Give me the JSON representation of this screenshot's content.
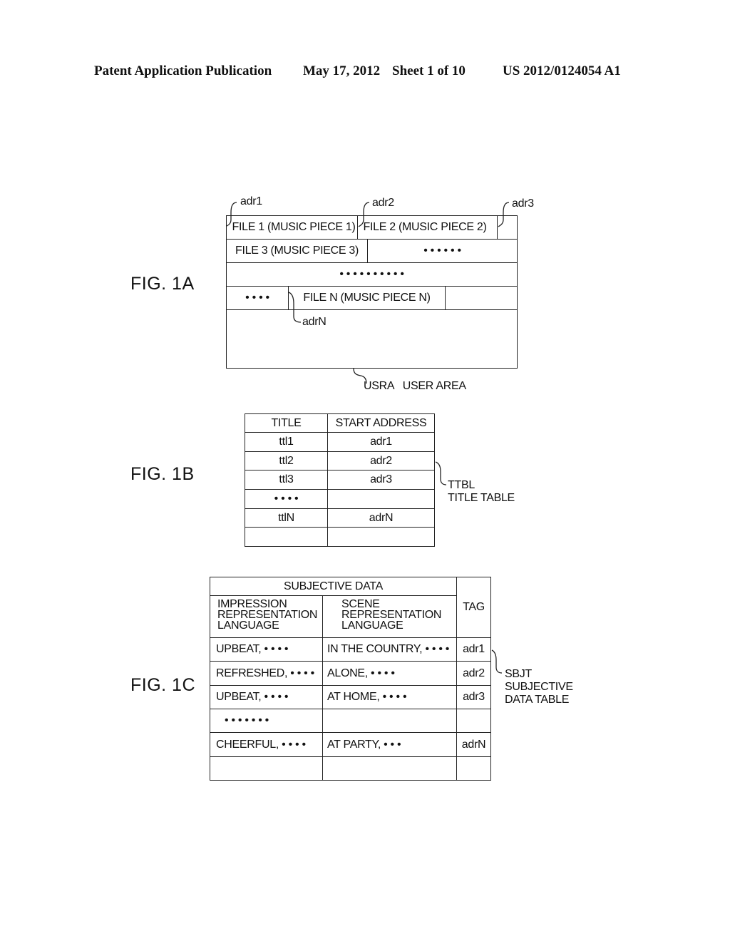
{
  "header": {
    "publication": "Patent Application Publication",
    "date": "May 17, 2012",
    "sheet": "Sheet 1 of 10",
    "number": "US 2012/0124054 A1"
  },
  "fig1a": {
    "label": "FIG. 1A",
    "address_labels": [
      "adr1",
      "adr2",
      "adr3",
      "adrN"
    ],
    "row1": [
      "FILE 1 (MUSIC PIECE 1)",
      "FILE 2 (MUSIC PIECE 2)",
      ""
    ],
    "row2": [
      "FILE 3 (MUSIC PIECE 3)",
      "• • • • • •"
    ],
    "row3": [
      "• • • • • • • • • •"
    ],
    "row4": [
      "• • • •",
      "FILE N (MUSIC PIECE N)",
      ""
    ],
    "area_label": "USRA   USER AREA"
  },
  "fig1b": {
    "label": "FIG. 1B",
    "columns": [
      "TITLE",
      "START ADDRESS"
    ],
    "rows": [
      [
        "ttl1",
        "adr1"
      ],
      [
        "ttl2",
        "adr2"
      ],
      [
        "ttl3",
        "adr3"
      ],
      [
        "• • • •",
        ""
      ],
      [
        "ttlN",
        "adrN"
      ],
      [
        "",
        ""
      ]
    ],
    "ref_code": "TTBL",
    "ref_name": "TITLE TABLE"
  },
  "fig1c": {
    "label": "FIG. 1C",
    "group_header": "SUBJECTIVE DATA",
    "columns": [
      "IMPRESSION\nREPRESENTATION\nLANGUAGE",
      "SCENE\nREPRESENTATION\nLANGUAGE",
      "TAG"
    ],
    "rows": [
      [
        "UPBEAT, • • • •",
        "IN THE COUNTRY, • • • •",
        "adr1"
      ],
      [
        "REFRESHED, • • • •",
        "ALONE, • • • •",
        "adr2"
      ],
      [
        "UPBEAT, • • • •",
        "AT HOME, • • • •",
        "adr3"
      ],
      [
        "• • • • • • •",
        "",
        ""
      ],
      [
        "CHEERFUL, • • • •",
        "AT PARTY, • • •",
        "adrN"
      ],
      [
        "",
        "",
        ""
      ]
    ],
    "ref_code": "SBJT",
    "ref_name_line1": "SUBJECTIVE",
    "ref_name_line2": "DATA TABLE"
  }
}
